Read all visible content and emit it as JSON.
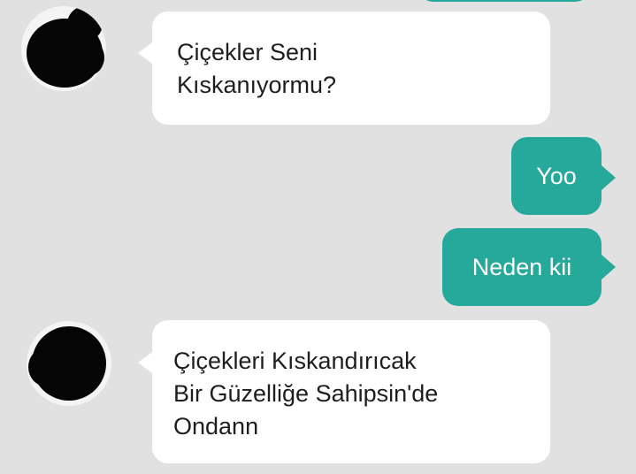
{
  "colors": {
    "background": "#e1e1e1",
    "incoming_bubble": "#ffffff",
    "outgoing_bubble": "#25a99b",
    "incoming_text": "#1e1e1e",
    "outgoing_text": "#ffffff"
  },
  "messages": [
    {
      "direction": "incoming",
      "text": "Çiçekler Seni\nKıskanıyormu?"
    },
    {
      "direction": "outgoing",
      "text": "Yoo"
    },
    {
      "direction": "outgoing",
      "text": "Neden kii"
    },
    {
      "direction": "incoming",
      "text": "Çiçekleri Kıskandırıcak\nBir Güzelliğe Sahipsin'de\nOndann"
    }
  ]
}
